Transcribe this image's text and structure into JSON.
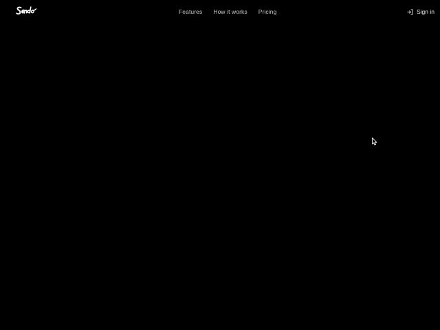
{
  "header": {
    "logo_text": "Sendo",
    "nav": [
      {
        "label": "Features"
      },
      {
        "label": "How it works"
      },
      {
        "label": "Pricing"
      }
    ],
    "signin": {
      "label": "Sign in",
      "icon": "sign-in-icon"
    }
  },
  "colors": {
    "background": "#000000",
    "nav_text": "#c9c9c9",
    "logo": "#ffffff"
  },
  "cursor": {
    "icon": "mouse-pointer-icon"
  }
}
